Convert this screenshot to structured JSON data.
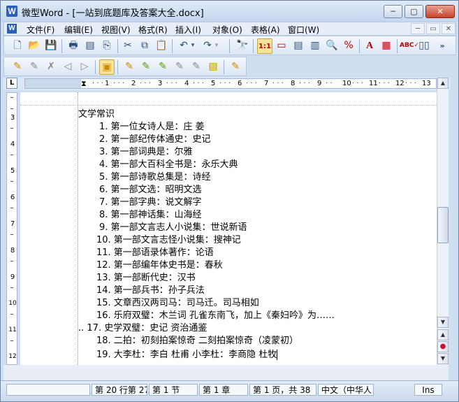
{
  "window": {
    "title": "微型Word - [一站到底题库及答案大全.docx]",
    "app_icon": "W",
    "controls": [
      "─",
      "▢",
      "✕"
    ]
  },
  "menubar": {
    "items": [
      "文件(F)",
      "编辑(E)",
      "视图(V)",
      "格式(R)",
      "插入(I)",
      "对象(O)",
      "表格(A)",
      "窗口(W)"
    ],
    "mdi_controls": [
      "─",
      "▭",
      "✕"
    ]
  },
  "toolbar1": {
    "icons": [
      "new-document-icon",
      "open-folder-icon",
      "save-icon",
      "print-icon",
      "pdf-icon",
      "cut-icon",
      "copy-icon",
      "paste-icon",
      "undo-icon",
      "redo-icon",
      "find-icon",
      "page-view-icon",
      "outline-view-icon",
      "normal-view-icon",
      "web-view-icon",
      "zoom-icon",
      "replace-icon",
      "font-icon",
      "paragraph-icon",
      "spellcheck-icon",
      "columns-icon",
      "more-icon"
    ]
  },
  "toolbar2": {
    "icons": [
      "insert-comment-icon",
      "edit-comment-icon",
      "delete-comment-icon",
      "previous-comment-icon",
      "next-comment-icon",
      "show-markup-icon",
      "accept-change-icon",
      "reject-change-icon",
      "accept-all-icon",
      "reject-all-icon",
      "track-changes-icon",
      "reviewing-pane-icon"
    ]
  },
  "ruler": {
    "corner": "L",
    "numbers": [
      "1",
      "2",
      "3",
      "4",
      "5",
      "6",
      "7",
      "8",
      "9",
      "10",
      "11",
      "12",
      "13"
    ]
  },
  "vruler": {
    "numbers": [
      "3",
      "4",
      "5",
      "6",
      "7",
      "8",
      "9",
      "10",
      "11",
      "12"
    ]
  },
  "document": {
    "heading": "文学常识",
    "items": [
      "1. 第一位女诗人是：庄 姜",
      "2. 第一部纪传体通史：史记",
      "3. 第一部词典是：尔雅",
      "4. 第一部大百科全书是：永乐大典",
      "5. 第一部诗歌总集是：诗经",
      "6. 第一部文选：昭明文选",
      "7. 第一部字典：说文解字",
      "8. 第一部神话集：山海经",
      "9. 第一部文言志人小说集：世说新语",
      "10. 第一部文言志怪小说集：搜神记",
      "11. 第一部语录体著作：论语",
      "12. 第一部编年体史书是：春秋",
      "13. 第一部断代史：汉书",
      "14. 第一部兵书：孙子兵法",
      "15. 文章西汉两司马：司马迁。司马相如",
      "16. 乐府双璧：木兰词 孔雀东南飞，加上《秦妇吟》为……",
      ".. 17. 史学双璧：史记 资治通鉴",
      "18. 二拍：初刻拍案惊奇 二刻拍案惊奇（凌蒙初）",
      "19. 大李杜：李白 杜甫 小李杜：李商隐 杜牧"
    ]
  },
  "scrollbar": {
    "up": "▲",
    "down": "▼",
    "page_up": "▲",
    "page_down": "▼",
    "marker": "●"
  },
  "statusbar": {
    "position": "第 20 行第 27",
    "section": "第 1 节",
    "chapter": "第 1 章",
    "page": "第 1 页，共 38",
    "language": "中文（中华人",
    "mode": "Ins"
  },
  "colors": {
    "window_bg": "#cfdff2",
    "title_bg": "#dfeaf7",
    "close_red": "#c6432c",
    "active_tool": "#f7e39a"
  }
}
